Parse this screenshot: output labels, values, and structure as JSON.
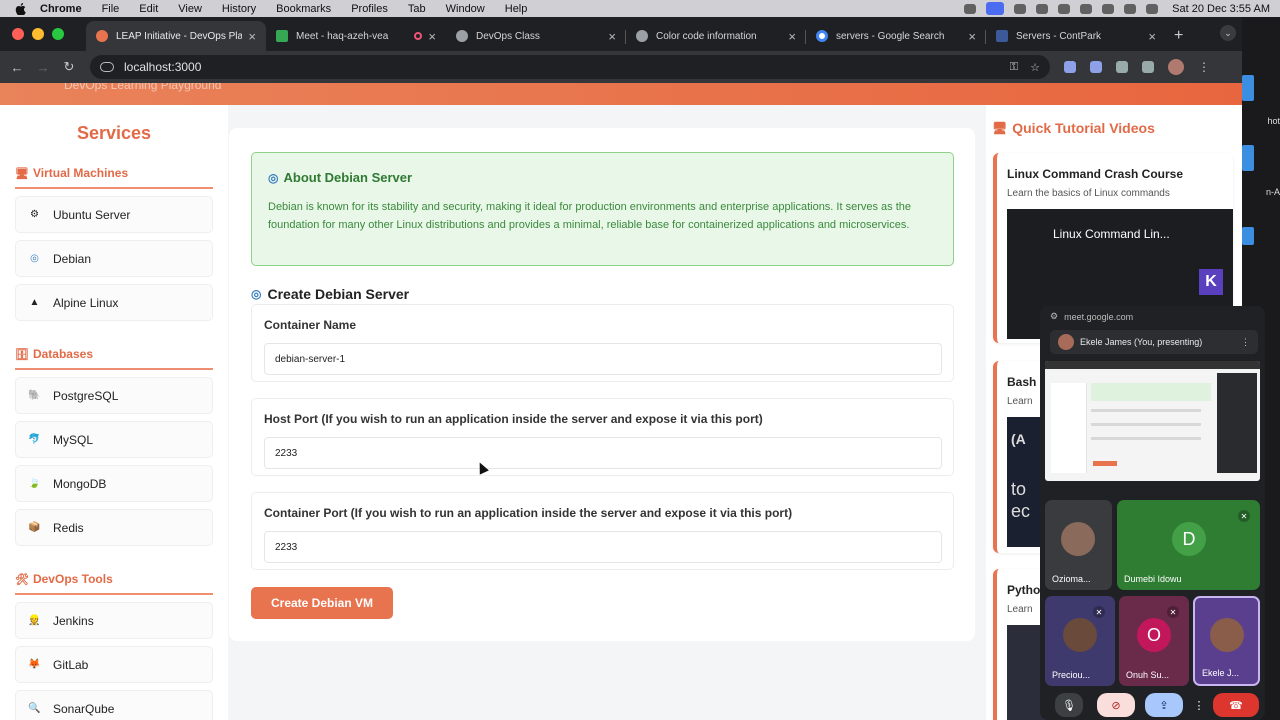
{
  "menubar": {
    "app": "Chrome",
    "items": [
      "File",
      "Edit",
      "View",
      "History",
      "Bookmarks",
      "Profiles",
      "Tab",
      "Window",
      "Help"
    ],
    "clock": "Sat 20 Dec  3:55 AM"
  },
  "tabs": [
    {
      "label": "LEAP Initiative - DevOps Play",
      "color": "#e8734f",
      "active": true
    },
    {
      "label": "Meet - haq-azeh-vea",
      "color": "#34a853",
      "active": false
    },
    {
      "label": "DevOps Class",
      "color": "#9aa0a6",
      "active": false
    },
    {
      "label": "Color code information",
      "color": "#9aa0a6",
      "active": false
    },
    {
      "label": "servers - Google Search",
      "color": "#4285f4",
      "active": false
    },
    {
      "label": "Servers - ContPark",
      "color": "#3c5a9a",
      "active": false
    }
  ],
  "address": {
    "url": "localhost:3000"
  },
  "edge_text": [
    "hot",
    "n-A"
  ],
  "banner": {
    "subtitle": "DevOps Learning Playground"
  },
  "sidebar": {
    "title": "Services",
    "sections": [
      {
        "heading": "Virtual Machines",
        "icon": "monitor-icon",
        "items": [
          {
            "label": "Ubuntu Server",
            "icon": "ubuntu-icon"
          },
          {
            "label": "Debian",
            "icon": "debian-icon"
          },
          {
            "label": "Alpine Linux",
            "icon": "mountain-icon"
          }
        ]
      },
      {
        "heading": "Databases",
        "icon": "database-icon",
        "items": [
          {
            "label": "PostgreSQL",
            "icon": "elephant-icon"
          },
          {
            "label": "MySQL",
            "icon": "dolphin-icon"
          },
          {
            "label": "MongoDB",
            "icon": "leaf-icon"
          },
          {
            "label": "Redis",
            "icon": "box-icon"
          }
        ]
      },
      {
        "heading": "DevOps Tools",
        "icon": "tools-icon",
        "items": [
          {
            "label": "Jenkins",
            "icon": "jenkins-icon"
          },
          {
            "label": "GitLab",
            "icon": "fox-icon"
          },
          {
            "label": "SonarQube",
            "icon": "magnifier-icon"
          }
        ]
      }
    ]
  },
  "about": {
    "title": "About Debian Server",
    "text": "Debian is known for its stability and security, making it ideal for production environments and enterprise applications. It serves as the foundation for many other Linux distributions and provides a minimal, reliable base for containerized applications and microservices."
  },
  "form": {
    "title": "Create Debian Server",
    "fields": [
      {
        "label": "Container Name",
        "value": "debian-server-1"
      },
      {
        "label": "Host Port (If you wish to run an application inside the server and expose it via this port)",
        "value": "2233"
      },
      {
        "label": "Container Port (If you wish to run an application inside the server and expose it via this port)",
        "value": "2233"
      }
    ],
    "submit": "Create Debian VM"
  },
  "tutorials": {
    "title": "Quick Tutorial Videos",
    "cards": [
      {
        "title": "Linux Command Crash Course",
        "subtitle": "Learn the basics of Linux commands",
        "video_title": "Linux Command Lin...",
        "badge": "K"
      },
      {
        "title": "Bash",
        "subtitle": "Learn",
        "video_text_1": "(A",
        "video_text_2": "to",
        "video_text_3": "ec"
      },
      {
        "title": "Pytho",
        "subtitle": "Learn"
      }
    ]
  },
  "meet": {
    "url": "meet.google.com",
    "presenter": "Ekele James (You, presenting)",
    "participants": [
      {
        "name": "Ozioma...",
        "initial": ""
      },
      {
        "name": "Dumebi Idowu",
        "initial": "D"
      },
      {
        "name": "Preciou...",
        "initial": ""
      },
      {
        "name": "Onuh Su...",
        "initial": "O"
      },
      {
        "name": "Ekele J...",
        "initial": ""
      }
    ]
  },
  "colors": {
    "accent": "#e8734f",
    "success_bg": "#e9f7e8",
    "success_text": "#2f7a33",
    "meet_green": "#2e7d32",
    "meet_purple": "#5b3f8f"
  }
}
